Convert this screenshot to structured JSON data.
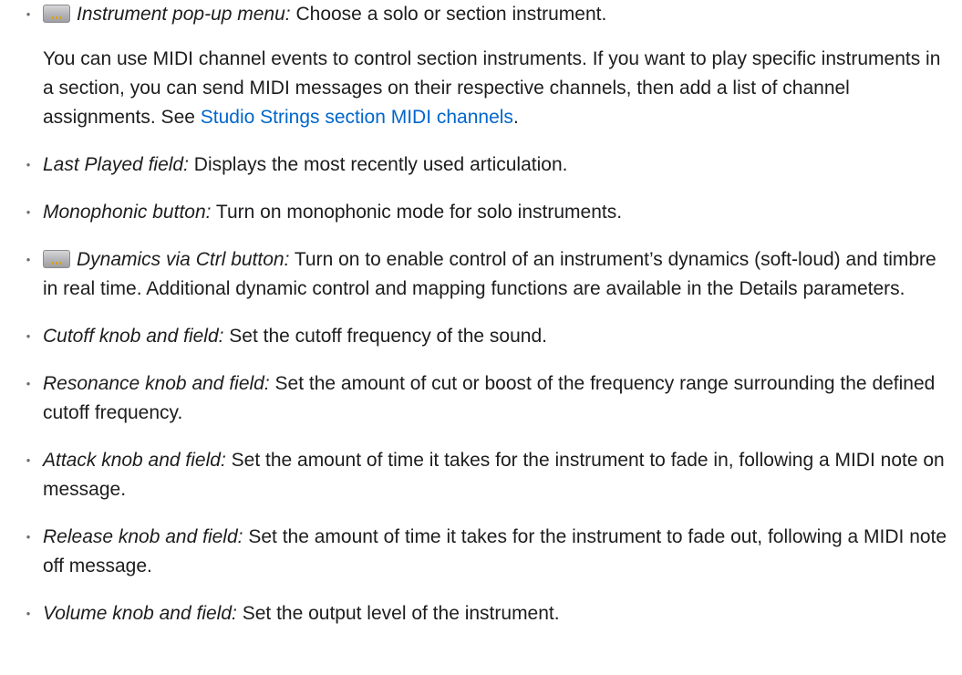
{
  "items": [
    {
      "label": "Instrument pop-up menu:",
      "text": " Choose a solo or section instrument.",
      "badge": "menu-badge-icon"
    },
    {
      "paragraph_before": "You can use MIDI channel events to control section instruments. If you want to play specific instruments in a section, you can send MIDI messages on their respective channels, then add a list of channel assignments. See ",
      "link_text": "Studio Strings section MIDI channels",
      "paragraph_after": "."
    },
    {
      "label": "Last Played field:",
      "text": " Displays the most recently used articulation."
    },
    {
      "label": "Monophonic button:",
      "text": " Turn on monophonic mode for solo instruments."
    },
    {
      "label": "Dynamics via Ctrl button:",
      "text": " Turn on to enable control of an instrument’s dynamics (soft-loud) and timbre in real time. Additional dynamic control and mapping functions are available in the Details parameters.",
      "badge": "menu-badge-icon"
    },
    {
      "label": "Cutoff knob and field:",
      "text": " Set the cutoff frequency of the sound."
    },
    {
      "label": "Resonance knob and field:",
      "text": " Set the amount of cut or boost of the frequency range surrounding the defined cutoff frequency."
    },
    {
      "label": "Attack knob and field:",
      "text": " Set the amount of time it takes for the instrument to fade in, following a MIDI note on message."
    },
    {
      "label": "Release knob and field:",
      "text": " Set the amount of time it takes for the instrument to fade out, following a MIDI note off message."
    },
    {
      "label": "Volume knob and field:",
      "text": " Set the output level of the instrument."
    }
  ],
  "colors": {
    "text": "#1d1d1f",
    "link": "#0066cc",
    "bullet": "#6e6e73"
  }
}
